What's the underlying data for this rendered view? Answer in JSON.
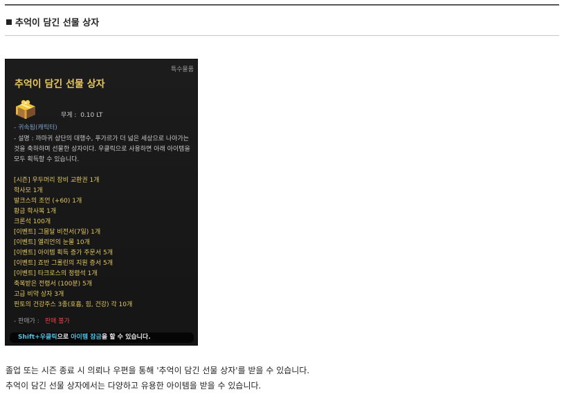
{
  "section": {
    "title": "추억이 담긴 선물 상자"
  },
  "tooltip": {
    "category": "특수물품",
    "name": "추억이 담긴 선물 상자",
    "icon": "gift-box-icon",
    "weight_label": "무게 :",
    "weight_value": "0.10 LT",
    "bound": "- 귀속됨(캐릭터)",
    "description": "- 설명 : 까마귀 상단의 대행수, 푸가르가 더 넓은 세상으로 나아가는 것을 축하하며 선물한 상자이다. 우클릭으로 사용하면 아래 아이템을 모두 획득할 수 있습니다.",
    "items": [
      "[시즌] 우두머리 장비 교환권 1개",
      "학사모 1개",
      "발크스의 조언 (+60) 1개",
      "황금 학사복 1개",
      "크론석 100개",
      "[이벤트] 그뭄달 비전서(7일) 1개",
      "[이벤트] 엘리언의 눈물 10개",
      "[이벤트] 아이템 획득 증가 주문서 5개",
      "[이벤트] 죠반 그롤린의 지원 증서 5개",
      "[이벤트] 타크로스의 정령석 1개",
      "축복받은 전령서 (100분) 5개",
      "고급 비약 상자 3개",
      "핀토의 건강주스 3종(호흡, 힘, 건강) 각 10개"
    ],
    "price_label": "- 판매가 :",
    "price_value": "판매 불가",
    "hint": {
      "key": "Shift+우클릭",
      "mid": "으로",
      "action": "아이템 잠금",
      "tail": "을 할 수 있습니다."
    },
    "colors": {
      "name": "#e8c860",
      "items": "#e2c65f",
      "bound": "#7d9ec6",
      "price": "#e04848",
      "hint": "#4fc3e8"
    }
  },
  "body": {
    "line1": "졸업 또는 시즌 종료 시 의뢰나 우편을 통해 '추억이 담긴 선물 상자'를 받을 수 있습니다.",
    "line2": "추억이 담긴 선물 상자에서는 다양하고 유용한 아이템을 받을 수 있습니다."
  }
}
